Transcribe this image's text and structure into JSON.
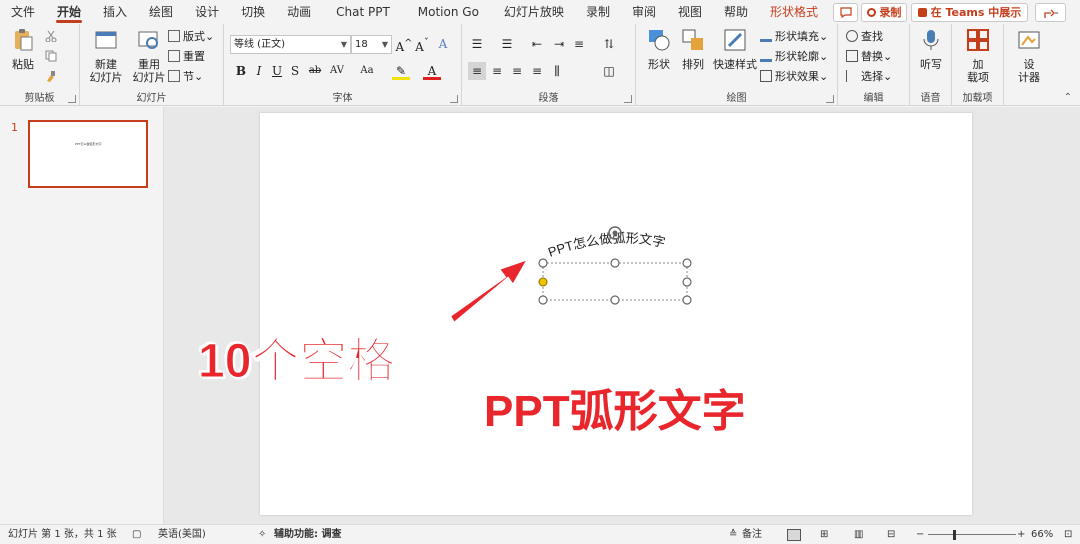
{
  "tabs": [
    "文件",
    "开始",
    "插入",
    "绘图",
    "设计",
    "切换",
    "动画",
    "Chat PPT",
    "Motion Go",
    "幻灯片放映",
    "录制",
    "审阅",
    "视图",
    "帮助",
    "形状格式"
  ],
  "title_right": {
    "record": "录制",
    "teams": "在 Teams 中展示"
  },
  "clipboard": {
    "paste": "粘贴",
    "label": "剪贴板"
  },
  "slides_group": {
    "new": "新建\n幻灯片",
    "reuse": "重用\n幻灯片",
    "layout": "版式",
    "reset": "重置",
    "section": "节",
    "label": "幻灯片"
  },
  "font_group": {
    "font_name": "等线 (正文)",
    "font_size": "18",
    "label": "字体"
  },
  "paragraph_group": {
    "label": "段落"
  },
  "drawing_group": {
    "shape": "形状",
    "arrange": "排列",
    "quick_style": "快速样式",
    "fill": "形状填充",
    "outline": "形状轮廓",
    "effect": "形状效果",
    "label": "绘图"
  },
  "editing_group": {
    "find": "查找",
    "replace": "替换",
    "select": "选择",
    "label": "编辑"
  },
  "voice_group": {
    "dictate": "听写",
    "label": "语音"
  },
  "addins_group": {
    "addins": "加\n载项",
    "label": "加载项"
  },
  "designer_group": {
    "designer": "设\n计器"
  },
  "slide_panel": {
    "num": "1",
    "thumb_text": "PPT怎么做弧形文字"
  },
  "slide": {
    "arc_text": "PPT怎么做弧形文字",
    "annotation": "10个空格",
    "headline": "PPT弧形文字"
  },
  "statusbar": {
    "slide_info": "幻灯片 第 1 张，共 1 张",
    "language": "英语(美国)",
    "accessibility": "辅助功能: 调查",
    "notes": "备注",
    "zoom": "66%"
  },
  "colors": {
    "accent": "#c43e1c",
    "red_text": "#e8262b"
  }
}
